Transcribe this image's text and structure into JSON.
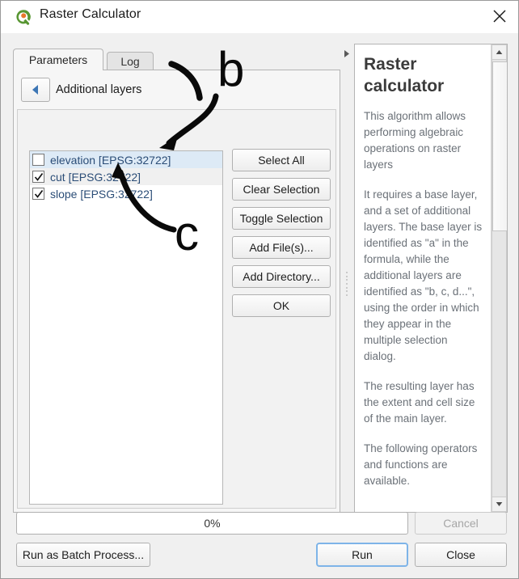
{
  "window": {
    "title": "Raster Calculator",
    "app_icon": "qgis-logo-icon",
    "close_icon": "close-icon"
  },
  "tabs": [
    {
      "label": "Parameters",
      "active": true
    },
    {
      "label": "Log",
      "active": false
    }
  ],
  "panel": {
    "back_icon": "back-arrow-icon",
    "heading": "Additional layers"
  },
  "layer_list": {
    "rows": [
      {
        "label": "elevation [EPSG:32722]",
        "checked": false,
        "selected": true
      },
      {
        "label": "cut [EPSG:32722]",
        "checked": true,
        "selected": false
      },
      {
        "label": "slope [EPSG:32722]",
        "checked": true,
        "selected": false
      }
    ]
  },
  "side_buttons": [
    {
      "label": "Select All"
    },
    {
      "label": "Clear Selection"
    },
    {
      "label": "Toggle Selection"
    },
    {
      "label": "Add File(s)..."
    },
    {
      "label": "Add Directory..."
    },
    {
      "label": "OK"
    }
  ],
  "help": {
    "title": "Raster calculator",
    "paragraphs": [
      "This algorithm allows performing algebraic operations on raster layers",
      "It requires a base layer, and a set of additional layers. The base layer is identified as \"a\" in the formula, while the additional layers are identified as \"b, c, d...\", using the order in which they appear in the multiple selection dialog.",
      "The resulting layer has the extent and cell size of the main layer.",
      "The following operators and functions are available."
    ],
    "scroll_up_icon": "scroll-up-arrow-icon",
    "scroll_down_icon": "scroll-down-arrow-icon"
  },
  "collapse_icon": "collapse-right-arrow-icon",
  "splitter": "panel-splitter-handle",
  "bottom": {
    "progress_label": "0%",
    "progress_value": 0,
    "cancel_label": "Cancel",
    "batch_label": "Run as Batch Process...",
    "run_label": "Run",
    "close_label": "Close"
  },
  "annotations": [
    {
      "letter": "b",
      "target": "cut-row"
    },
    {
      "letter": "c",
      "target": "slope-row"
    }
  ],
  "colors": {
    "accent_blue": "#7eb4e8",
    "selection_blue": "#ddeaf6",
    "layer_text": "#2b4d77",
    "help_text": "#6b7178",
    "qgis_green": "#589632",
    "qgis_orange": "#e8772c"
  }
}
